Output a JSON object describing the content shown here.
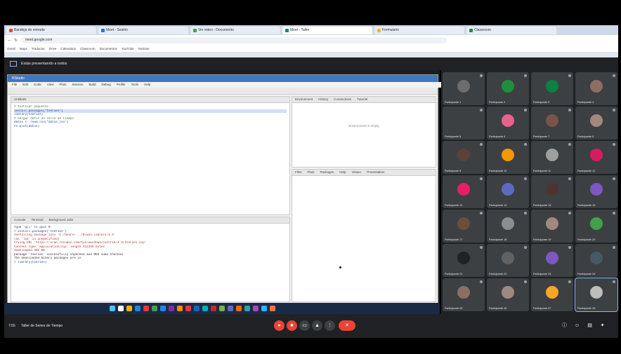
{
  "browser": {
    "tabs": [
      {
        "label": "Bandeja de entrada",
        "color": "#ea4335",
        "active": false
      },
      {
        "label": "Meet - Sesión",
        "color": "#1a73e8",
        "active": false
      },
      {
        "label": "Ver video - Documento",
        "color": "#34a853",
        "active": false
      },
      {
        "label": "Meet - Taller",
        "color": "#00897b",
        "active": true
      },
      {
        "label": "Formulario",
        "color": "#fbbc04",
        "active": false
      },
      {
        "label": "Classroom",
        "color": "#1e8e3e",
        "active": false
      }
    ],
    "url": "meet.google.com",
    "bookmarks": [
      "Gmail",
      "Maps",
      "Traductor",
      "Drive",
      "Calendario",
      "Classroom",
      "Documentos",
      "YouTube",
      "Noticias"
    ]
  },
  "presentation_bar": {
    "text": "Estás presentando a todos"
  },
  "rstudio": {
    "title": "RStudio",
    "menu": [
      "File",
      "Edit",
      "Code",
      "View",
      "Plots",
      "Session",
      "Build",
      "Debug",
      "Profile",
      "Tools",
      "Help"
    ],
    "editor_tab": "Untitled1",
    "editor_lines": [
      "# Instalar paquetes",
      "install.packages(\"tseries\")",
      "library(tseries)",
      "",
      "# Cargar datos de serie de tiempo",
      "datos <- read.csv(\"datos.csv\")",
      "ts.plot(datos)"
    ],
    "env_tabs": [
      "Environment",
      "History",
      "Connections",
      "Tutorial"
    ],
    "env_empty": "Environment is empty",
    "files_tabs": [
      "Files",
      "Plots",
      "Packages",
      "Help",
      "Viewer",
      "Presentation"
    ],
    "console_tabs": [
      "Console",
      "Terminal",
      "Background Jobs"
    ],
    "console_lines": [
      "Type 'q()' to quit R.",
      "",
      "> install.packages(\"tseries\")",
      "Installing package into ‘C:/Users/.../R/win-library/4.3’",
      "(as ‘lib’ is unspecified)",
      "trying URL 'https://cran.rstudio.com/bin/windows/contrib/4.3/tseries.zip'",
      "Content type 'application/zip' length 412345 bytes",
      "downloaded 402 KB",
      "",
      "package ‘tseries’ successfully unpacked and MD5 sums checked",
      "",
      "The downloaded binary packages are in",
      "> library(tseries)"
    ]
  },
  "meeting": {
    "title": "Taller de Series de Tiempo",
    "time": "7:55"
  },
  "participants": [
    {
      "name": "Participante 1",
      "color": "#6d6d6d"
    },
    {
      "name": "Participante 2",
      "color": "#1e8e3e"
    },
    {
      "name": "Participante 3",
      "color": "#0b8043"
    },
    {
      "name": "Participante 4",
      "color": "#8d6e63"
    },
    {
      "name": "Participante 5",
      "color": "#3c4043"
    },
    {
      "name": "Participante 6",
      "color": "#e8618c"
    },
    {
      "name": "Participante 7",
      "color": "#795548"
    },
    {
      "name": "Participante 8",
      "color": "#a1887f"
    },
    {
      "name": "Participante 9",
      "color": "#5d4037"
    },
    {
      "name": "Participante 10",
      "color": "#f29900"
    },
    {
      "name": "Participante 11",
      "color": "#9e9e9e"
    },
    {
      "name": "Participante 12",
      "color": "#d81b60"
    },
    {
      "name": "Participante 13",
      "color": "#e91e63"
    },
    {
      "name": "Participante 14",
      "color": "#5c6bc0"
    },
    {
      "name": "Participante 15",
      "color": "#4e342e"
    },
    {
      "name": "Participante 16",
      "color": "#7e57c2"
    },
    {
      "name": "Participante 17",
      "color": "#6d4c41"
    },
    {
      "name": "Participante 18",
      "color": "#8d8d8d"
    },
    {
      "name": "Participante 19",
      "color": "#a1887f"
    },
    {
      "name": "Participante 20",
      "color": "#43a047"
    },
    {
      "name": "Participante 21",
      "color": "#212121"
    },
    {
      "name": "Participante 22",
      "color": "#616161"
    },
    {
      "name": "Participante 23",
      "color": "#7e57c2"
    },
    {
      "name": "Participante 24",
      "color": "#455a64"
    },
    {
      "name": "Participante 25",
      "color": "#8d6e63"
    },
    {
      "name": "Participante 26",
      "color": "#a1887f"
    },
    {
      "name": "Participante 27",
      "color": "#f9a825"
    },
    {
      "name": "Participante 28",
      "color": "#bdbdbd"
    }
  ]
}
